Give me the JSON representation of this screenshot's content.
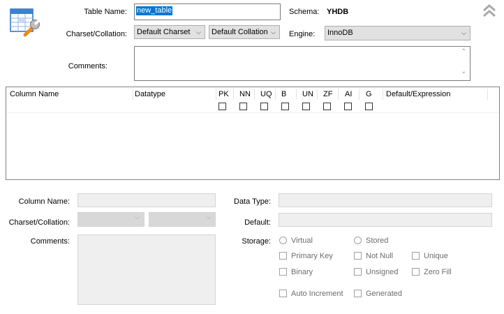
{
  "header": {
    "table_name_label": "Table Name:",
    "table_name_value": "new_table",
    "schema_label": "Schema:",
    "schema_value": "YHDB",
    "charset_label": "Charset/Collation:",
    "charset_value": "Default Charset",
    "collation_value": "Default Collation",
    "engine_label": "Engine:",
    "engine_value": "InnoDB",
    "comments_label": "Comments:",
    "collapse_icon": "double-chevron-up-icon",
    "table_icon": "table-wrench-icon"
  },
  "columns_grid": {
    "headers": [
      "Column Name",
      "Datatype",
      "PK",
      "NN",
      "UQ",
      "B",
      "UN",
      "ZF",
      "AI",
      "G",
      "Default/Expression"
    ],
    "rows": []
  },
  "details": {
    "column_name_label": "Column Name:",
    "charset_label": "Charset/Collation:",
    "comments_label": "Comments:",
    "data_type_label": "Data Type:",
    "default_label": "Default:",
    "storage_label": "Storage:",
    "storage_options": [
      "Virtual",
      "Stored"
    ],
    "flags": [
      "Primary Key",
      "Not Null",
      "Unique",
      "Binary",
      "Unsigned",
      "Zero Fill",
      "Auto Increment",
      "Generated"
    ]
  }
}
